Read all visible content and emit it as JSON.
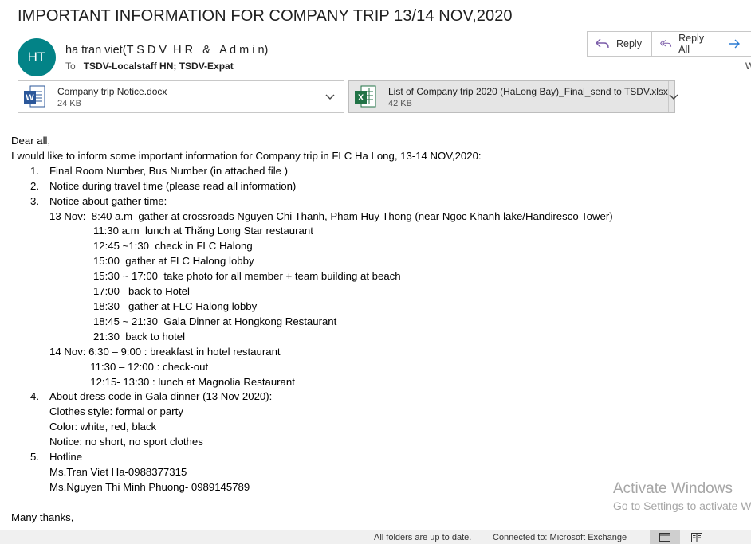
{
  "subject": "IMPORTANT INFORMATION FOR COMPANY TRIP 13/14 NOV,2020",
  "sender": {
    "initials": "HT",
    "name": "ha tran viet(T S D V  H R   &   A d m i n)",
    "to_label": "To",
    "to_names": "TSDV-Localstaff HN; TSDV-Expat"
  },
  "actions": {
    "reply": "Reply",
    "reply_all": "Reply All",
    "date_fragment": "W"
  },
  "attachments": [
    {
      "name": "Company trip Notice.docx",
      "size": "24 KB",
      "type": "word"
    },
    {
      "name": "List of Company trip 2020 (HaLong Bay)_Final_send to TSDV.xlsx",
      "size": "42 KB",
      "type": "excel"
    }
  ],
  "body": {
    "greeting": "Dear all,",
    "intro": "I would like to inform some important information for Company trip in FLC Ha Long, 13-14 NOV,2020:",
    "items": [
      {
        "num": "1.",
        "text": "Final Room Number, Bus Number (in attached file )"
      },
      {
        "num": "2.",
        "text": "Notice during travel time (please read all information)"
      },
      {
        "num": "3.",
        "text": "Notice about gather time:"
      }
    ],
    "schedule": [
      "13 Nov:  8:40 a.m  gather at crossroads Nguyen Chi Thanh, Pham Huy Thong (near Ngoc Khanh lake/Handiresco Tower)",
      "               11:30 a.m  lunch at Thăng Long Star restaurant",
      "               12:45 ~1:30  check in FLC Halong",
      "               15:00  gather at FLC Halong lobby",
      "               15:30 ~ 17:00  take photo for all member + team building at beach",
      "               17:00   back to Hotel",
      "               18:30   gather at FLC Halong lobby",
      "               18:45 ~ 21:30  Gala Dinner at Hongkong Restaurant",
      "               21:30  back to hotel",
      "14 Nov: 6:30 – 9:00 : breakfast in hotel restaurant",
      "              11:30 – 12:00 : check-out",
      "              12:15- 13:30 : lunch at Magnolia Restaurant"
    ],
    "item4": {
      "num": "4.",
      "text": "About dress code in Gala dinner (13 Nov 2020):"
    },
    "dress": [
      "Clothes style: formal or party",
      "Color: white, red, black",
      "Notice: no short, no sport clothes"
    ],
    "item5": {
      "num": "5.",
      "text": "Hotline"
    },
    "hotline": [
      "Ms.Tran Viet Ha-0988377315",
      "Ms.Nguyen Thi Minh Phuong- 0989145789"
    ],
    "closing": "Many thanks,"
  },
  "watermark": {
    "line1": "Activate Windows",
    "line2": "Go to Settings to activate W"
  },
  "statusbar": {
    "sync": "All folders are up to date.",
    "connection": "Connected to: Microsoft Exchange"
  },
  "colors": {
    "avatar_bg": "#038387",
    "reply_icon": "#7a5ba8",
    "forward_icon": "#2b7cd3",
    "word_blue": "#2b579a",
    "excel_green": "#217346"
  }
}
